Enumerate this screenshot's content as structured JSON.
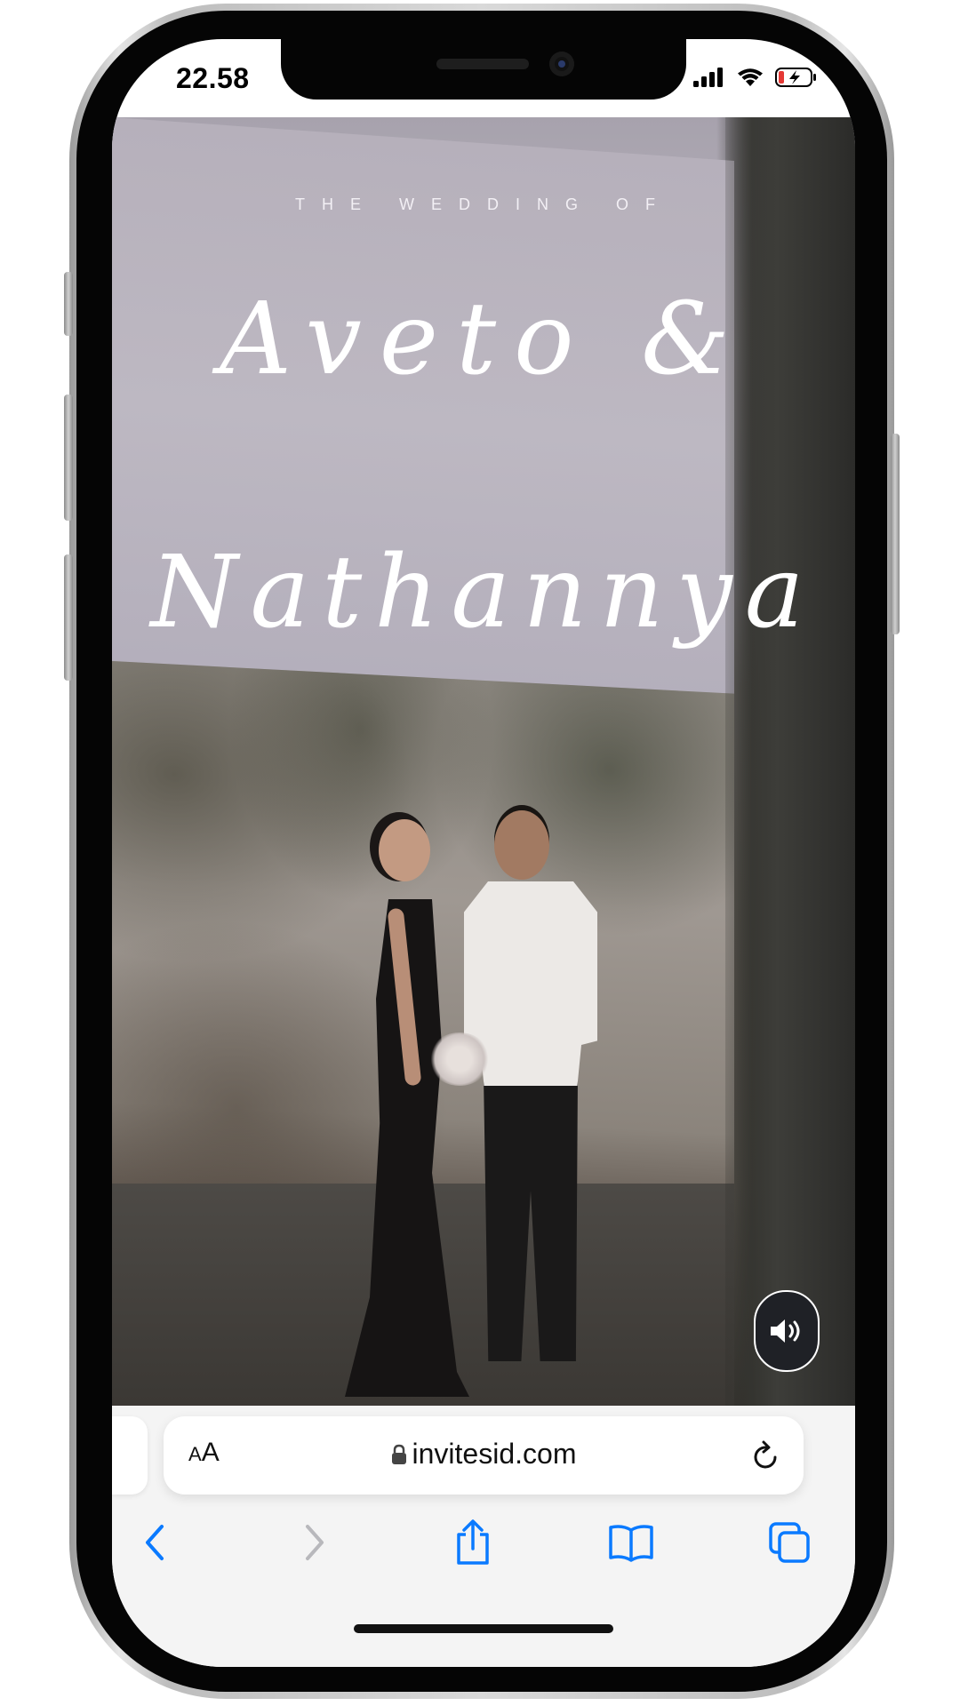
{
  "status_bar": {
    "time": "22.58"
  },
  "invitation": {
    "heading": "THE WEDDING OF",
    "name_1": "Aveto &",
    "name_2": "Nathannya"
  },
  "browser": {
    "text_size_label_small": "A",
    "text_size_label_large": "A",
    "url": "invitesid.com"
  },
  "icons": {
    "back": "chevron-left-icon",
    "forward": "chevron-right-icon",
    "share": "share-icon",
    "bookmarks": "book-icon",
    "tabs": "tabs-icon",
    "sound": "speaker-icon",
    "reload": "reload-icon",
    "lock": "lock-icon"
  },
  "colors": {
    "accent": "#0a7aff",
    "disabled": "#b8b8bc"
  }
}
